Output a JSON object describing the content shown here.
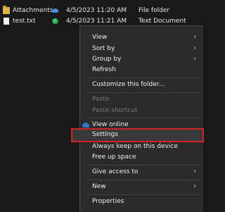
{
  "files": [
    {
      "name": "Attachments",
      "date": "4/5/2023 11:20 AM",
      "type": "File folder",
      "icon": "folder-icon",
      "status_icon": "cloud-icon"
    },
    {
      "name": "test.txt",
      "date": "4/5/2023 11:21 AM",
      "type": "Text Document",
      "icon": "text-file-icon",
      "status_icon": "green-check-icon"
    }
  ],
  "menu": {
    "view": "View",
    "sort_by": "Sort by",
    "group_by": "Group by",
    "refresh": "Refresh",
    "customize": "Customize this folder...",
    "paste": "Paste",
    "paste_shortcut": "Paste shortcut",
    "view_online": "View online",
    "settings": "Settings",
    "always_keep": "Always keep on this device",
    "free_up": "Free up space",
    "give_access": "Give access to",
    "new": "New",
    "properties": "Properties"
  },
  "colors": {
    "highlight_border": "#d12525",
    "menu_bg": "#2b2b2b",
    "page_bg": "#191919"
  }
}
